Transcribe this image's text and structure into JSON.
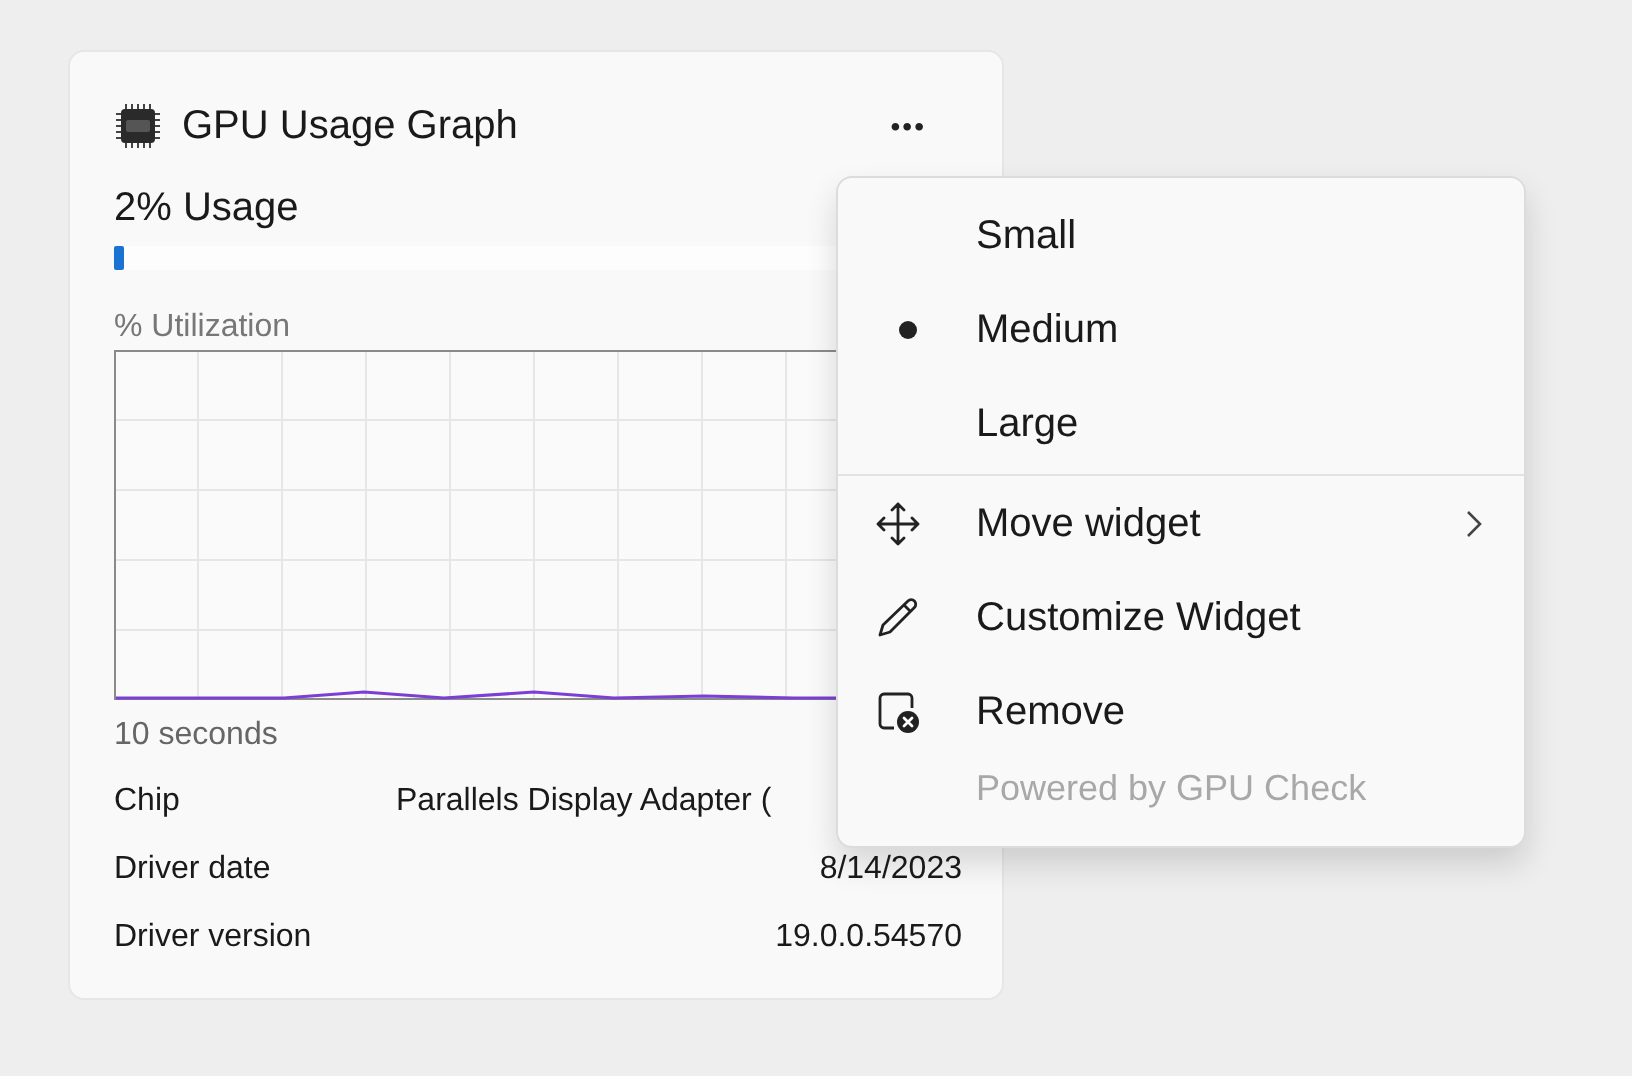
{
  "widget": {
    "title": "GPU Usage Graph",
    "more_button": "•••",
    "usage": {
      "label": "2% Usage",
      "level": 0.02
    },
    "graph": {
      "title": "% Utilization",
      "time_label": "10 seconds"
    },
    "details": [
      {
        "label": "Chip",
        "value": "Parallels Display Adapter ("
      },
      {
        "label": "Driver date",
        "value": "8/14/2023"
      },
      {
        "label": "Driver version",
        "value": "19.0.0.54570"
      }
    ]
  },
  "menu": {
    "sizes": [
      {
        "label": "Small",
        "selected": false
      },
      {
        "label": "Medium",
        "selected": true
      },
      {
        "label": "Large",
        "selected": false
      }
    ],
    "actions": [
      {
        "kind": "move",
        "label": "Move widget",
        "submenu": true
      },
      {
        "kind": "customize",
        "label": "Customize Widget",
        "submenu": false
      },
      {
        "kind": "remove",
        "label": "Remove",
        "submenu": false
      }
    ],
    "footer": "Powered by GPU Check"
  }
}
